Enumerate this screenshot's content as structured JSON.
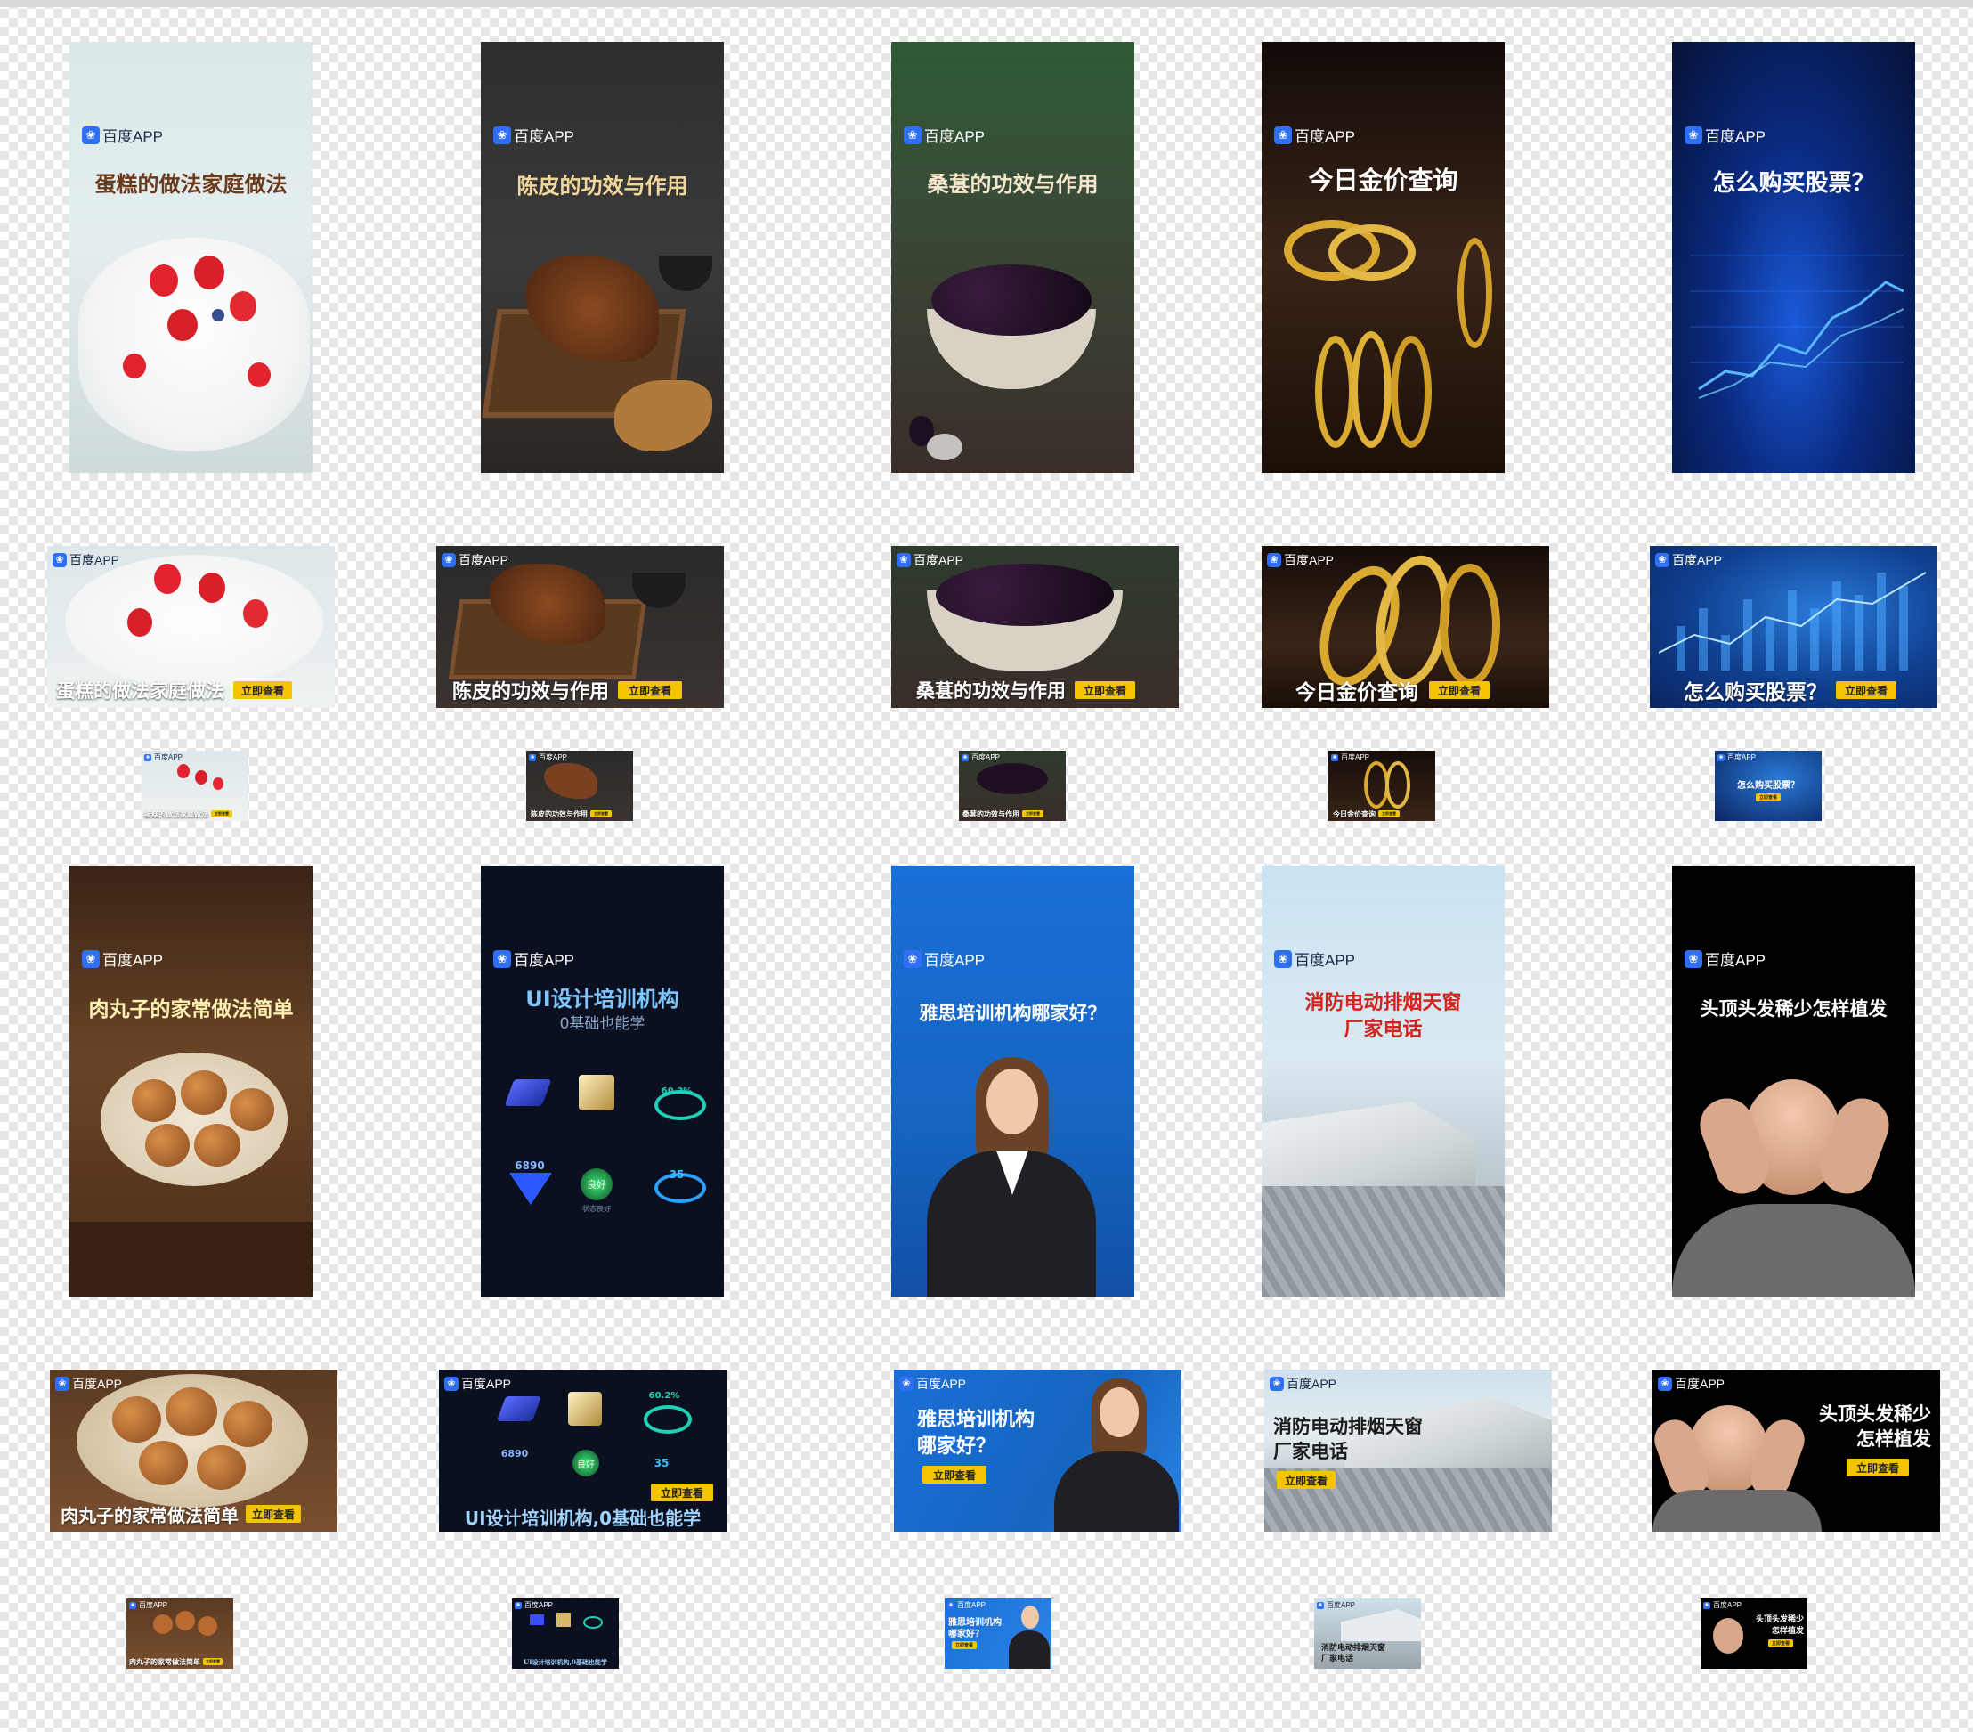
{
  "brand": "百度APP",
  "cta": "立即查看",
  "colors": {
    "cake_bg": "#d7e6e6",
    "chenpi_bg": "#2b2b2b",
    "mulberry_bg": "#2f4a2f",
    "gold_bg": "#2a1a10",
    "stock_bg": "#071a4a",
    "meatball_bg": "#5a3a20",
    "ui_bg": "#0b1020",
    "ielts_bg": "#1565c0",
    "vent_bg": "#cfe3f0",
    "hair_bg": "#000000",
    "cta": "#f5c400"
  },
  "row1": [
    {
      "title": "蛋糕的做法家庭做法"
    },
    {
      "title": "陈皮的功效与作用"
    },
    {
      "title": "桑葚的功效与作用"
    },
    {
      "title": "今日金价查询"
    },
    {
      "title": "怎么购买股票？"
    }
  ],
  "row4": [
    {
      "title": "肉丸子的家常做法简单"
    },
    {
      "title": "UI设计培训机构",
      "subtitle": "0基础也能学"
    },
    {
      "title": "雅思培训机构哪家好？"
    },
    {
      "title": "消防电动排烟天窗",
      "title2": "厂家电话"
    },
    {
      "title": "头顶头发稀少怎样植发"
    }
  ],
  "ui_stats": {
    "pct": "60.2%",
    "num": "6890",
    "good": "良好",
    "count": "35",
    "state": "状态良好"
  },
  "row5": {
    "ui_title": "UI设计培训机构,0基础也能学",
    "ielts_l1": "雅思培训机构",
    "ielts_l2": "哪家好？",
    "vent_l1": "消防电动排烟天窗",
    "vent_l2": "厂家电话",
    "hair_l1": "头顶头发稀少",
    "hair_l2": "怎样植发"
  },
  "icons": [
    "paw-icon"
  ]
}
